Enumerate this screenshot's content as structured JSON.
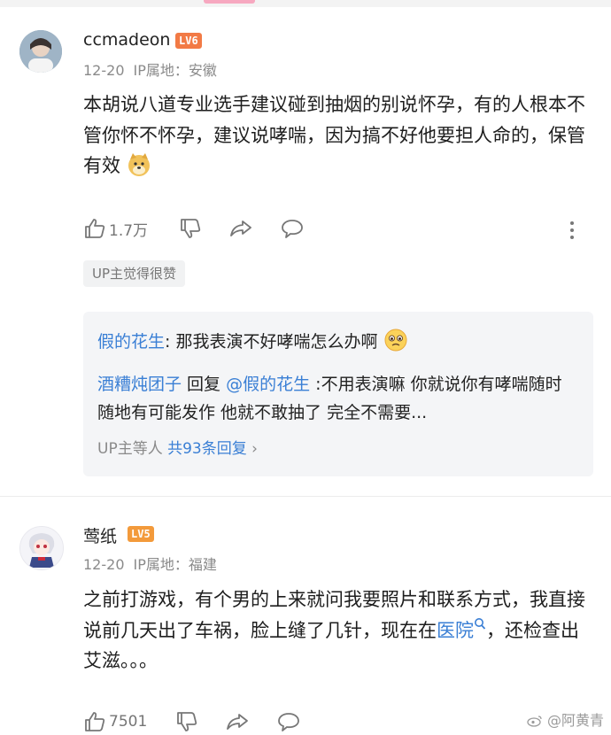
{
  "comments": [
    {
      "username": "ccmadeon",
      "level": "LV6",
      "date": "12-20",
      "ip": "IP属地：安徽",
      "text": "本胡说八道专业选手建议碰到抽烟的别说怀孕，有的人根本不管你怀不怀孕，建议说哮喘，因为搞不好他要担人命的，保管有效",
      "emoji": "doge-emoji",
      "likes": "1.7万",
      "up_tag": "UP主觉得很赞",
      "replies": [
        {
          "name": "假的花生",
          "sep": ": ",
          "text": "那我表演不好哮喘怎么办啊",
          "emoji": "worried-emoji"
        },
        {
          "name": "酒糟炖团子",
          "verb": " 回复 ",
          "target": "@假的花生",
          "text": " :不用表演嘛 你就说你有哮喘随时随地有可能发作 他就不敢抽了 完全不需要..."
        }
      ],
      "more_replies": {
        "prefix": "UP主等人 ",
        "count": "共93条回复",
        "chevron": "›"
      }
    },
    {
      "username": "莺纸",
      "level": "LV5",
      "date": "12-20",
      "ip": "IP属地：福建",
      "text_before": "之前打游戏，有个男的上来就问我要照片和联系方式，我直接说前几天出了车祸，脸上缝了几针，现在在",
      "link": "医院",
      "text_after": "，还检查出艾滋。。。",
      "likes": "7501"
    }
  ],
  "watermark": "@阿黄青",
  "colors": {
    "link": "#3a7fd5",
    "level6": "#f27a45",
    "level5": "#f39a3b",
    "meta": "#8a8a8a"
  }
}
